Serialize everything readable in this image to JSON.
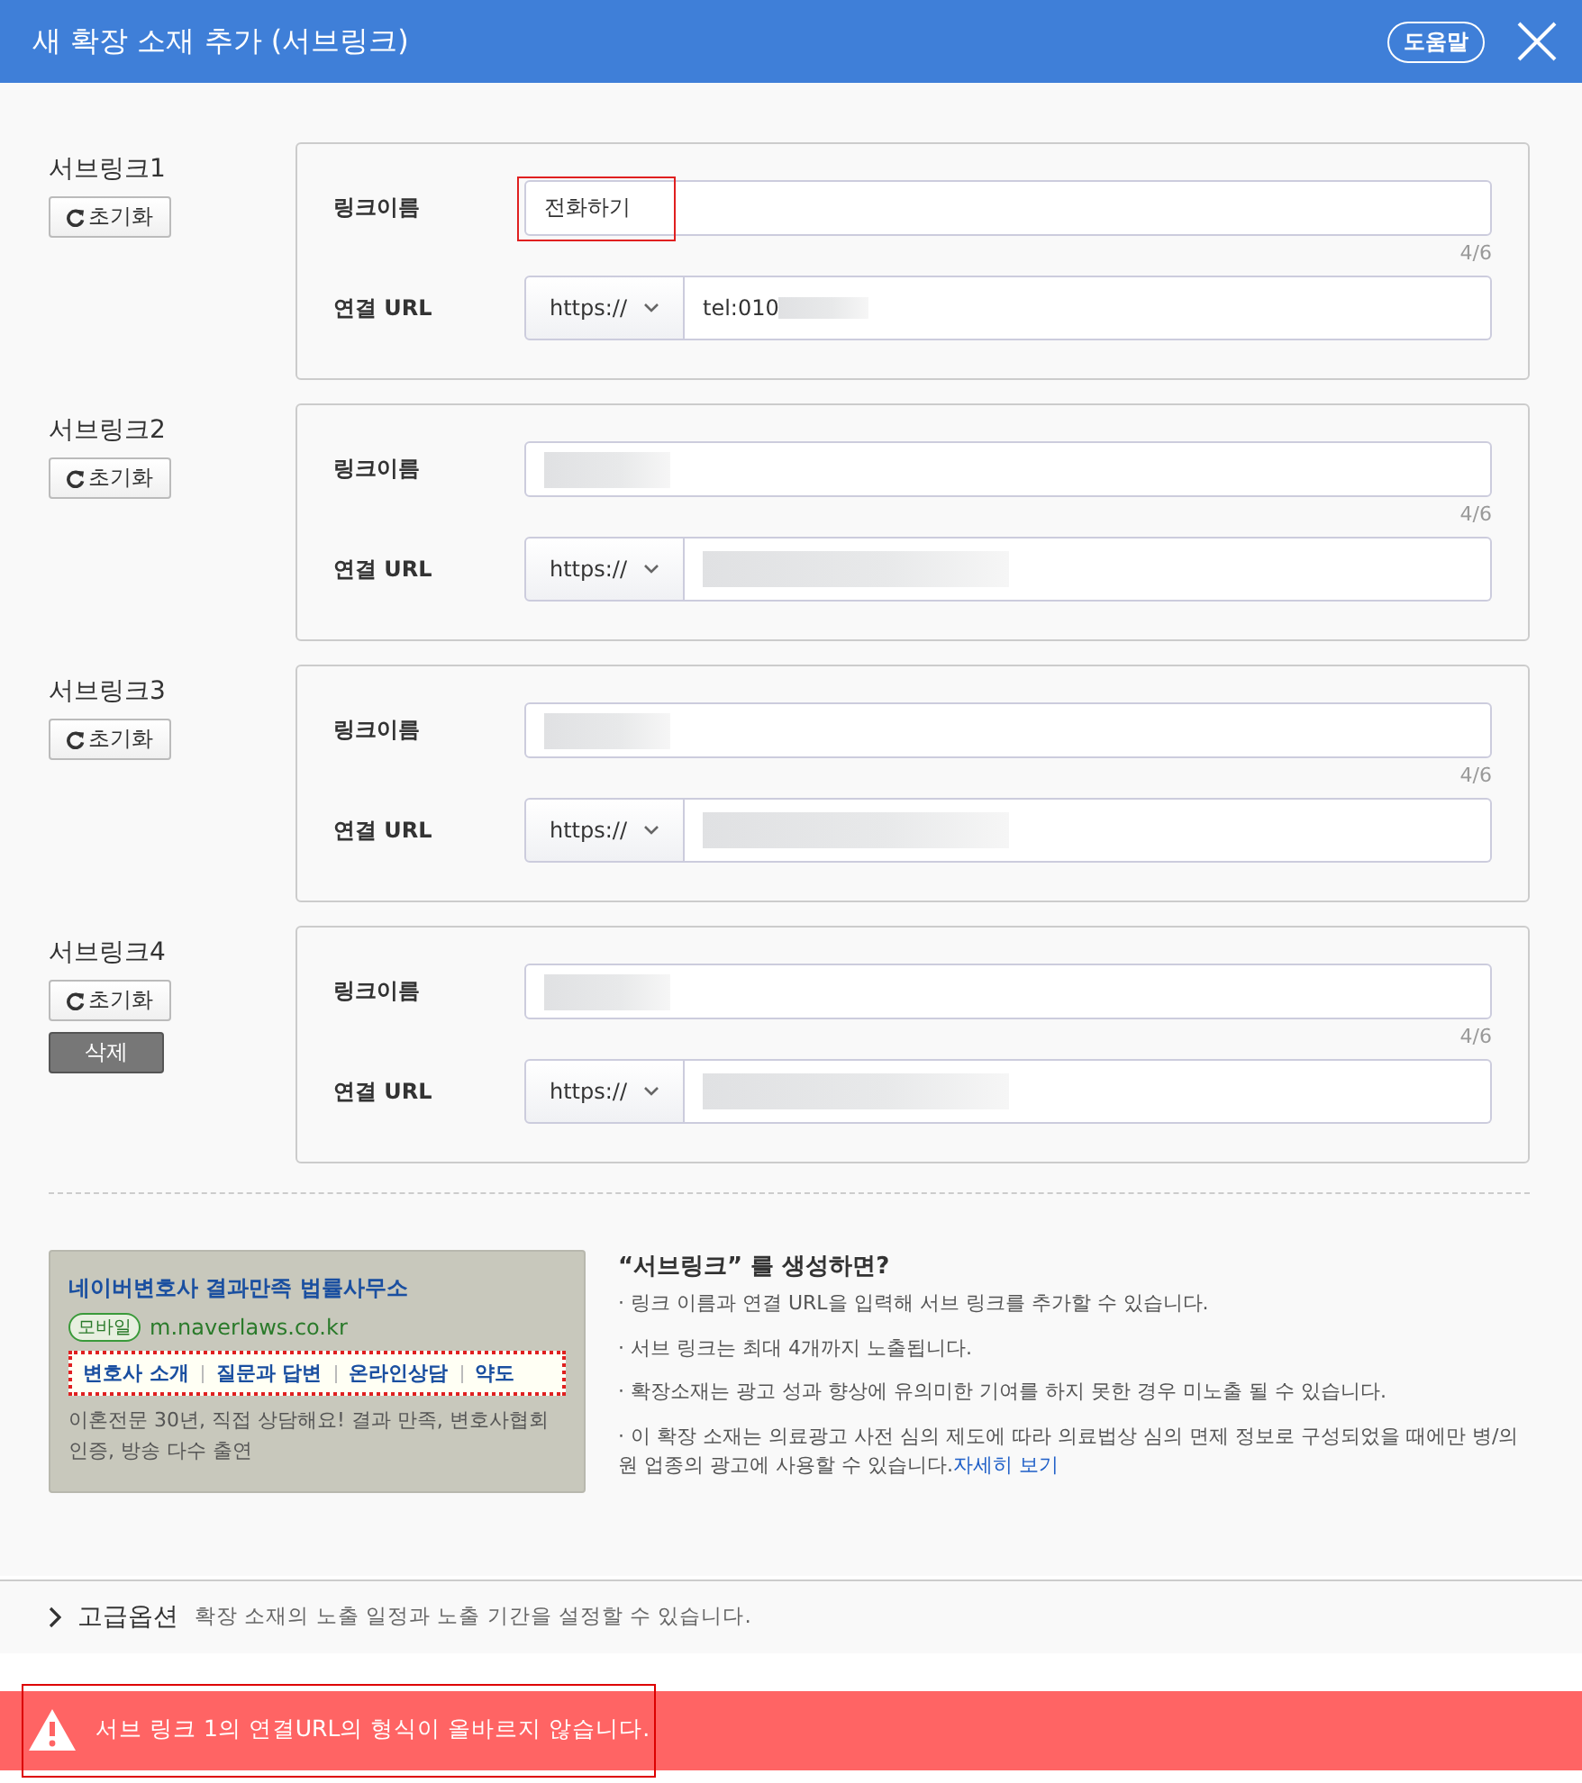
{
  "window": {
    "title": "새 확장 소재 추가 (서브링크)",
    "help_button": "도움말"
  },
  "sublinks": [
    {
      "title": "서브링크1",
      "reset": "초기화",
      "name_label": "링크이름",
      "name_value": "전화하기",
      "name_blurred": false,
      "highlighted": true,
      "counter": "4/6",
      "url_label": "연결 URL",
      "protocol": "https://",
      "url_value": "tel:010",
      "url_blurred": true
    },
    {
      "title": "서브링크2",
      "reset": "초기화",
      "name_label": "링크이름",
      "name_blurred": true,
      "highlighted": false,
      "counter": "4/6",
      "url_label": "연결 URL",
      "protocol": "https://",
      "url_blurred": true
    },
    {
      "title": "서브링크3",
      "reset": "초기화",
      "name_label": "링크이름",
      "name_blurred": true,
      "highlighted": false,
      "counter": "4/6",
      "url_label": "연결 URL",
      "protocol": "https://",
      "url_blurred": true
    },
    {
      "title": "서브링크4",
      "reset": "초기화",
      "delete": "삭제",
      "name_label": "링크이름",
      "name_blurred": true,
      "highlighted": false,
      "counter": "4/6",
      "url_label": "연결 URL",
      "protocol": "https://",
      "url_blurred": true
    }
  ],
  "preview": {
    "title": "네이버변호사 결과만족 법률사무소",
    "badge": "모바일",
    "url": "m.naverlaws.co.kr",
    "links": [
      "변호사 소개",
      "질문과 답변",
      "온라인상담",
      "약도"
    ],
    "description": "이혼전문 30년, 직접 상담해요! 결과 만족, 변호사협회 인증, 방송 다수 출연"
  },
  "info": {
    "heading": "“서브링크” 를 생성하면?",
    "bullets": [
      "· 링크 이름과 연결 URL을 입력해 서브 링크를 추가할 수 있습니다.",
      "· 서브 링크는 최대 4개까지 노출됩니다.",
      "· 확장소재는 광고 성과 향상에 유의미한 기여를 하지 못한 경우 미노출 될 수 있습니다.",
      "· 이 확장 소재는 의료광고 사전 심의 제도에 따라 의료법상 심의 면제 정보로 구성되었을 때에만 병/의원 업종의 광고에 사용할 수 있습니다."
    ],
    "link": "자세히 보기"
  },
  "advanced": {
    "label": "고급옵션",
    "description": "확장 소재의 노출 일정과 노출 기간을 설정할 수 있습니다."
  },
  "error": {
    "message": "서브 링크 1의 연결URL의 형식이 올바르지 않습니다.",
    "highlighted": true
  }
}
